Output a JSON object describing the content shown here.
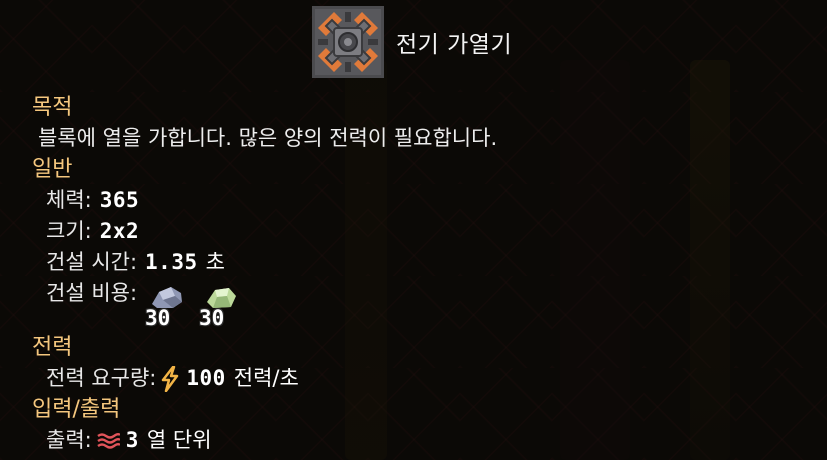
{
  "block": {
    "title": "전기 가열기",
    "icon": "electric-heater-block-icon"
  },
  "sections": {
    "purpose": {
      "title": "목적",
      "description": "블록에 열을 가합니다. 많은 양의 전력이 필요합니다."
    },
    "general": {
      "title": "일반",
      "health_label": "체력:",
      "health_value": "365",
      "size_label": "크기:",
      "size_value": "2x2",
      "build_time_label": "건설 시간:",
      "build_time_value": "1.35",
      "build_time_unit": "초",
      "build_cost_label": "건설 비용:",
      "costs": [
        {
          "item": "lead",
          "icon": "lead-ore-icon",
          "amount": "30",
          "color": "#9aa3bf"
        },
        {
          "item": "silicon",
          "icon": "silicon-icon",
          "amount": "30",
          "color": "#c9e6a6"
        }
      ]
    },
    "power": {
      "title": "전력",
      "usage_label": "전력 요구량:",
      "usage_icon": "lightning-icon",
      "usage_value": "100",
      "usage_unit": "전력/초"
    },
    "io": {
      "title": "입력/출력",
      "output_label": "출력:",
      "output_icon": "heat-waves-icon",
      "output_value": "3",
      "output_unit": "열 단위"
    }
  },
  "colors": {
    "section_title": "#f5c77e",
    "text": "#ededed",
    "power_icon": "#f2b446",
    "heat_icon": "#e0545a"
  }
}
